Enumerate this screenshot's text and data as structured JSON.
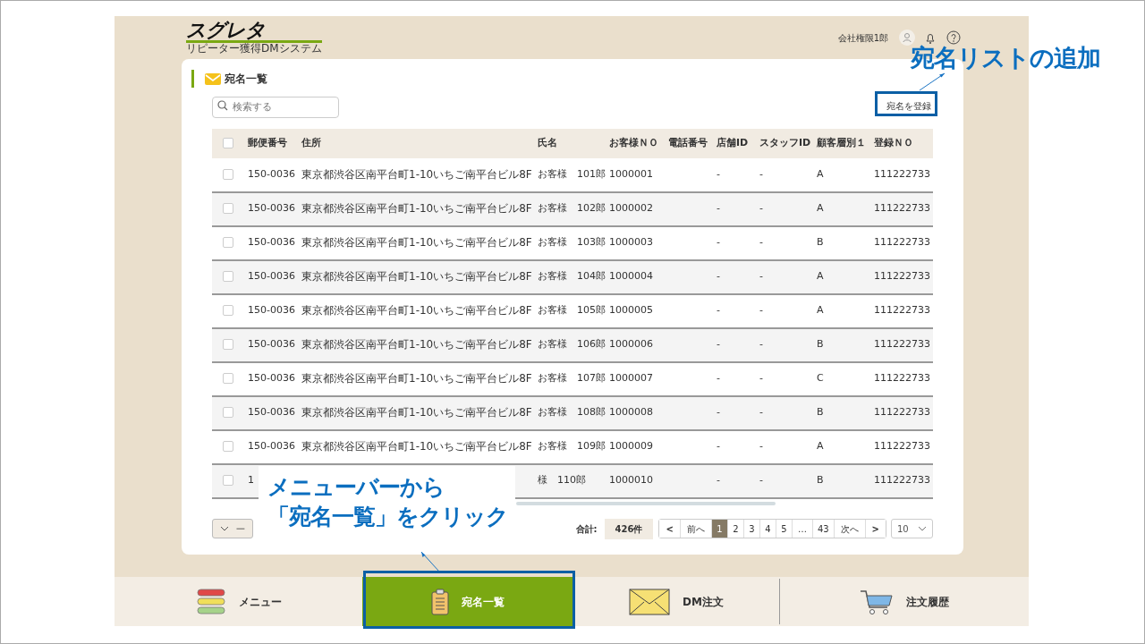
{
  "header": {
    "logo": "スグレタ",
    "logo_subtitle": "リピーター獲得DMシステム",
    "user_name": "会社権限1郎"
  },
  "page": {
    "title": "宛名一覧",
    "search": {
      "placeholder": "検索する"
    },
    "register_button": "宛名を登録"
  },
  "table": {
    "all_checked": false,
    "columns": [
      "郵便番号",
      "住所",
      "氏名",
      "お客様ＮＯ",
      "電話番号",
      "店舗ID",
      "スタッフID",
      "顧客層別１",
      "登録ＮＯ"
    ],
    "rows": [
      {
        "checked": false,
        "cells": [
          "150-0036",
          "東京都渋谷区南平台町1-10いちご南平台ビル8F",
          "お客様　101郎",
          "1000001",
          "",
          "-",
          "-",
          "A",
          "111222733"
        ]
      },
      {
        "checked": false,
        "cells": [
          "150-0036",
          "東京都渋谷区南平台町1-10いちご南平台ビル8F",
          "お客様　102郎",
          "1000002",
          "",
          "-",
          "-",
          "A",
          "111222733"
        ]
      },
      {
        "checked": false,
        "cells": [
          "150-0036",
          "東京都渋谷区南平台町1-10いちご南平台ビル8F",
          "お客様　103郎",
          "1000003",
          "",
          "-",
          "-",
          "B",
          "111222733"
        ]
      },
      {
        "checked": false,
        "cells": [
          "150-0036",
          "東京都渋谷区南平台町1-10いちご南平台ビル8F",
          "お客様　104郎",
          "1000004",
          "",
          "-",
          "-",
          "A",
          "111222733"
        ]
      },
      {
        "checked": false,
        "cells": [
          "150-0036",
          "東京都渋谷区南平台町1-10いちご南平台ビル8F",
          "お客様　105郎",
          "1000005",
          "",
          "-",
          "-",
          "A",
          "111222733"
        ]
      },
      {
        "checked": false,
        "cells": [
          "150-0036",
          "東京都渋谷区南平台町1-10いちご南平台ビル8F",
          "お客様　106郎",
          "1000006",
          "",
          "-",
          "-",
          "B",
          "111222733"
        ]
      },
      {
        "checked": false,
        "cells": [
          "150-0036",
          "東京都渋谷区南平台町1-10いちご南平台ビル8F",
          "お客様　107郎",
          "1000007",
          "",
          "-",
          "-",
          "C",
          "111222733"
        ]
      },
      {
        "checked": false,
        "cells": [
          "150-0036",
          "東京都渋谷区南平台町1-10いちご南平台ビル8F",
          "お客様　108郎",
          "1000008",
          "",
          "-",
          "-",
          "B",
          "111222733"
        ]
      },
      {
        "checked": false,
        "cells": [
          "150-0036",
          "東京都渋谷区南平台町1-10いちご南平台ビル8F",
          "お客様　109郎",
          "1000009",
          "",
          "-",
          "-",
          "A",
          "111222733"
        ]
      },
      {
        "checked": false,
        "cells": [
          "1",
          "",
          "様　110郎",
          "1000010",
          "",
          "-",
          "-",
          "B",
          "111222733"
        ]
      }
    ]
  },
  "footer": {
    "bulk_button": "一",
    "total_label": "合計:",
    "total": "426件",
    "pagination": [
      {
        "label": "<",
        "kind": "arrow",
        "selected": false
      },
      {
        "label": "前へ",
        "kind": "text",
        "selected": false
      },
      {
        "label": "1",
        "kind": "page",
        "selected": true
      },
      {
        "label": "2",
        "kind": "page",
        "selected": false
      },
      {
        "label": "3",
        "kind": "page",
        "selected": false
      },
      {
        "label": "4",
        "kind": "page",
        "selected": false
      },
      {
        "label": "5",
        "kind": "page",
        "selected": false
      },
      {
        "label": "…",
        "kind": "ellipsis",
        "selected": false
      },
      {
        "label": "43",
        "kind": "page",
        "selected": false
      },
      {
        "label": "次へ",
        "kind": "text",
        "selected": false
      },
      {
        "label": ">",
        "kind": "arrow",
        "selected": false
      }
    ],
    "page_size": "10"
  },
  "nav": [
    {
      "label": "メニュー",
      "selected": false
    },
    {
      "label": "宛名一覧",
      "selected": true
    },
    {
      "label": "DM注文",
      "selected": false
    },
    {
      "label": "注文履歴",
      "selected": false
    }
  ],
  "annotations": [
    {
      "kind": "title",
      "text": "宛名リストの追加"
    },
    {
      "kind": "callout",
      "lines": [
        "メニューバーから",
        "「宛名一覧」をクリック"
      ]
    }
  ]
}
